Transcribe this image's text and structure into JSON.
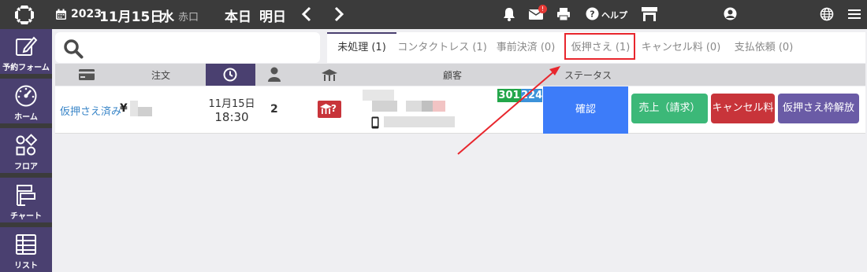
{
  "header": {
    "year": "2023",
    "date": "11月15日",
    "day_of_week": "水",
    "venue": "赤口",
    "today_label": "本日",
    "tomorrow_label": "明日",
    "mail_badge": "!",
    "help_label": "ヘルプ"
  },
  "sidebar": {
    "items": [
      {
        "label": "予約フォーム",
        "icon": "edit-icon"
      },
      {
        "label": "ホーム",
        "icon": "dashboard-icon"
      },
      {
        "label": "フロア",
        "icon": "floor-icon"
      },
      {
        "label": "チャート",
        "icon": "chart-icon"
      },
      {
        "label": "リスト",
        "icon": "list-icon"
      }
    ]
  },
  "search": {
    "placeholder": ""
  },
  "tabs": [
    {
      "label": "未処理 (1)",
      "active": true
    },
    {
      "label": "コンタクトレス (1)"
    },
    {
      "label": "事前決済 (0)"
    },
    {
      "label": "仮押さえ (1)",
      "highlighted": true
    },
    {
      "label": "キャンセル料 (0)"
    },
    {
      "label": "支払依頼 (0)"
    }
  ],
  "columns": {
    "order": "注文",
    "customer": "顧客",
    "status": "ステータス"
  },
  "reservation": {
    "state": "仮押さえ済み",
    "currency": "¥",
    "date": "11月15日",
    "time": "18:30",
    "party_size": "2",
    "seat_mark": "?",
    "table_tags": [
      "301",
      "224"
    ],
    "status_action": "確認",
    "actions": {
      "sales": "売上（請求）",
      "cancel_fee": "キャンセル料",
      "release": "仮押さえ枠解放"
    }
  },
  "colors": {
    "topbar": "#3b3b3b",
    "sidebar_item": "#4a4070",
    "confirm": "#3d7cf9",
    "sales": "#3cb878",
    "cancel": "#c8343a",
    "release": "#6a5ba6",
    "annotation": "#e8262d"
  }
}
